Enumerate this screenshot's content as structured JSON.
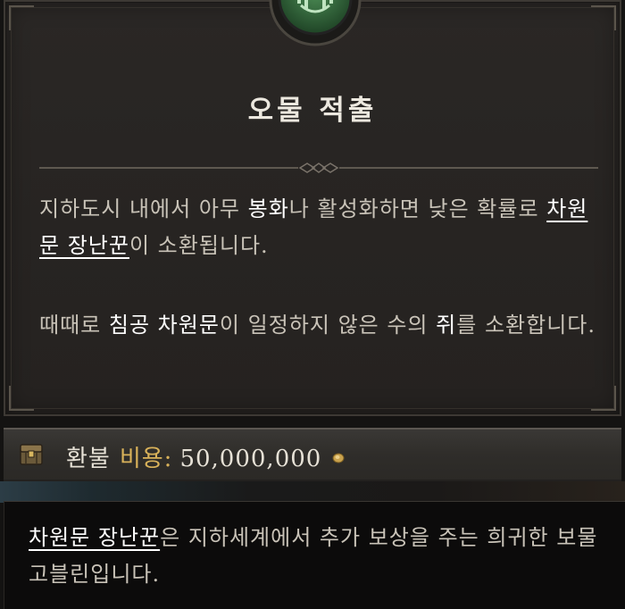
{
  "tooltip": {
    "title": "오물 적출",
    "paragraph1": {
      "part1": "지하도시 내에서 아무 ",
      "keyword1": "봉화",
      "part2": "나 활성화하면 낮은 확률로 ",
      "link": "차원문 장난꾼",
      "part3": "이 소환됩니다."
    },
    "paragraph2": {
      "part1": "때때로 ",
      "keyword1": "침공 차원문",
      "part2": "이 일정하지 않은 수의 ",
      "keyword2": "쥐",
      "part3": "를 소환합니다."
    }
  },
  "cost": {
    "label": "환불",
    "key": "비용:",
    "value": "50,000,000",
    "icon": "coffer-icon",
    "currency_icon": "gold-coin-icon"
  },
  "info_tooltip": {
    "link": "차원문 장난꾼",
    "text": "은 지하세계에서 추가 보상을 주는 희귀한 보물 고블린입니다."
  },
  "colors": {
    "panel_bg": "#272422",
    "highlight": "#ffffff",
    "body_text": "#c9c3b8",
    "cost_key": "#d9b25a",
    "emblem_green": "#2f6b3a"
  }
}
